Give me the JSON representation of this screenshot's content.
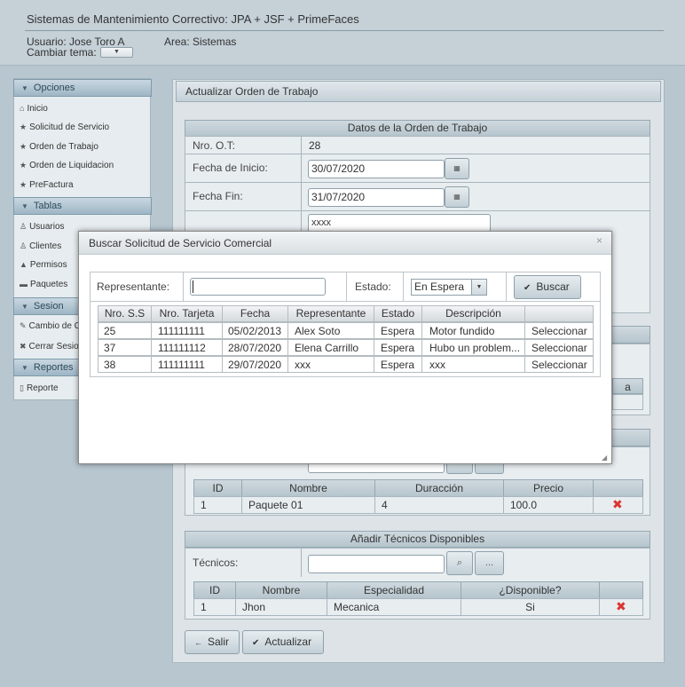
{
  "header": {
    "title": "Sistemas de Mantenimiento Correctivo: JPA + JSF + PrimeFaces",
    "user": "Usuario: Jose Toro A",
    "area": "Area: Sistemas",
    "theme_label": "Cambiar tema:",
    "theme_select_glyph": "▼"
  },
  "menu": {
    "sections": [
      {
        "label": "Opciones",
        "items": [
          "Inicio",
          "Solicitud de Servicio",
          "Orden de Trabajo",
          "Orden de Liquidacion",
          "PreFactura"
        ]
      },
      {
        "label": "Tablas",
        "items": [
          "Usuarios",
          "Clientes",
          "Permisos",
          "Paquetes"
        ]
      },
      {
        "label": "Sesion",
        "items": [
          "Cambio de C",
          "Cerrar Sesio"
        ]
      },
      {
        "label": "Reportes",
        "items": [
          "Reporte"
        ]
      }
    ]
  },
  "main": {
    "title": "Actualizar Orden de Trabajo",
    "section_title": "Datos de la Orden de Trabajo",
    "fields": {
      "ot_label": "Nro. O.T:",
      "ot_value": "28",
      "start_label": "Fecha de Inicio:",
      "start_value": "30/07/2020",
      "end_label": "Fecha Fin:",
      "end_value": "31/07/2020",
      "desc_value": "xxxx"
    },
    "hidden_col_letter": "a",
    "packages_table": {
      "headers": [
        "ID",
        "Nombre",
        "Duracción",
        "Precio"
      ],
      "rows": [
        [
          "1",
          "Paquete 01",
          "4",
          "100.0"
        ]
      ]
    },
    "technicians": {
      "title": "Añadir Técnicos Disponibles",
      "label": "Técnicos:",
      "input_value": "",
      "more_label": "...",
      "table_headers": [
        "ID",
        "Nombre",
        "Especialidad",
        "¿Disponible?"
      ],
      "rows": [
        [
          "1",
          "Jhon",
          "Mecanica",
          "Si"
        ]
      ]
    },
    "buttons": {
      "back": "Salir",
      "update": "Actualizar"
    }
  },
  "dialog": {
    "title": "Buscar Solicitud de Servicio Comercial",
    "close_glyph": "×",
    "rep_label": "Representante:",
    "rep_value": "",
    "estado_label": "Estado:",
    "estado_value": "En Espera",
    "buscar_label": "Buscar",
    "table": {
      "headers": [
        "Nro. S.S",
        "Nro. Tarjeta",
        "Fecha",
        "Representante",
        "Estado",
        "Descripción"
      ],
      "rows": [
        [
          "25",
          "111111111",
          "05/02/2013",
          "Alex Soto",
          "Espera",
          "Motor fundido",
          "Seleccionar"
        ],
        [
          "37",
          "111111112",
          "28/07/2020",
          "Elena Carrillo",
          "Espera",
          "Hubo un problem...",
          "Seleccionar"
        ],
        [
          "38",
          "111111111",
          "29/07/2020",
          "xxx",
          "Espera",
          "xxx",
          "Seleccionar"
        ]
      ]
    }
  },
  "colors": {
    "background": "#b7c6cf",
    "header_bg": "#c5d0d7",
    "delete_icon": "#dd3333"
  }
}
